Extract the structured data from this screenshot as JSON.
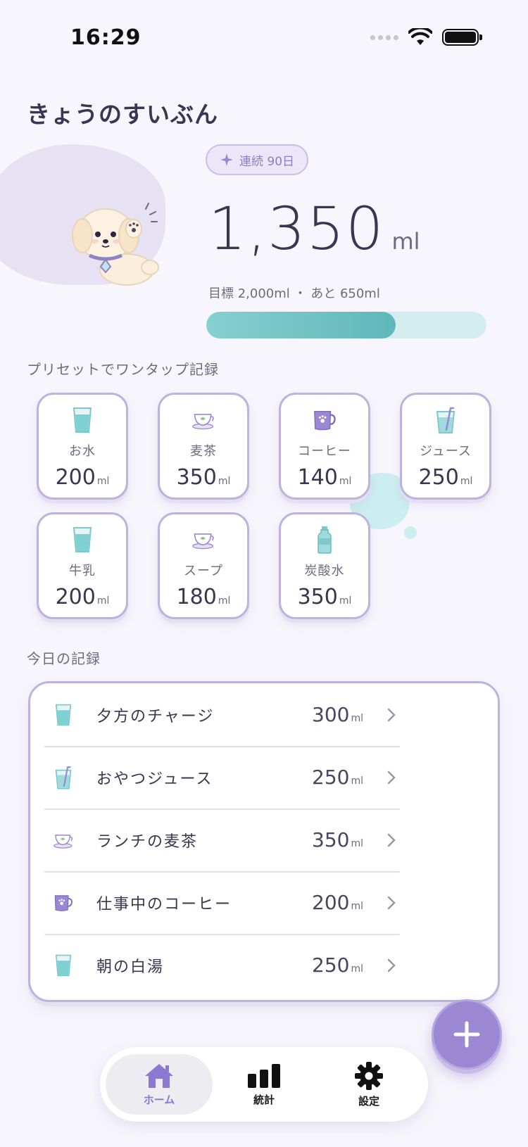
{
  "status_bar": {
    "time": "16:29"
  },
  "header": {
    "title": "きょうのすいぶん"
  },
  "summary": {
    "streak_label": "連続 90日",
    "amount": "1,350",
    "unit": "ml",
    "goal_text": "目標 2,000ml ・ あと 650ml",
    "progress": 0.675
  },
  "presets": {
    "section_label": "プリセットでワンタップ記録",
    "items": [
      {
        "label": "お水",
        "amount": "200",
        "unit": "ml",
        "icon": "water-glass-icon"
      },
      {
        "label": "麦茶",
        "amount": "350",
        "unit": "ml",
        "icon": "tea-cup-icon"
      },
      {
        "label": "コーヒー",
        "amount": "140",
        "unit": "ml",
        "icon": "coffee-mug-icon"
      },
      {
        "label": "ジュース",
        "amount": "250",
        "unit": "ml",
        "icon": "juice-glass-icon"
      },
      {
        "label": "牛乳",
        "amount": "200",
        "unit": "ml",
        "icon": "water-glass-icon"
      },
      {
        "label": "スープ",
        "amount": "180",
        "unit": "ml",
        "icon": "tea-cup-icon"
      },
      {
        "label": "炭酸水",
        "amount": "350",
        "unit": "ml",
        "icon": "bottle-icon"
      }
    ]
  },
  "log": {
    "section_label": "今日の記録",
    "items": [
      {
        "name": "夕方のチャージ",
        "amount": "300",
        "unit": "ml",
        "icon": "water-glass-icon"
      },
      {
        "name": "おやつジュース",
        "amount": "250",
        "unit": "ml",
        "icon": "juice-glass-icon"
      },
      {
        "name": "ランチの麦茶",
        "amount": "350",
        "unit": "ml",
        "icon": "tea-cup-icon"
      },
      {
        "name": "仕事中のコーヒー",
        "amount": "200",
        "unit": "ml",
        "icon": "coffee-mug-icon"
      },
      {
        "name": "朝の白湯",
        "amount": "250",
        "unit": "ml",
        "icon": "water-glass-icon"
      }
    ]
  },
  "tabs": [
    {
      "label": "ホーム",
      "icon": "home-icon",
      "active": true
    },
    {
      "label": "統計",
      "icon": "bar-chart-icon",
      "active": false
    },
    {
      "label": "設定",
      "icon": "gear-icon",
      "active": false
    }
  ],
  "colors": {
    "accent": "#9a88d3",
    "water": "#6cc4c6",
    "card_border": "#bdb3dc",
    "text": "#3a3552"
  }
}
